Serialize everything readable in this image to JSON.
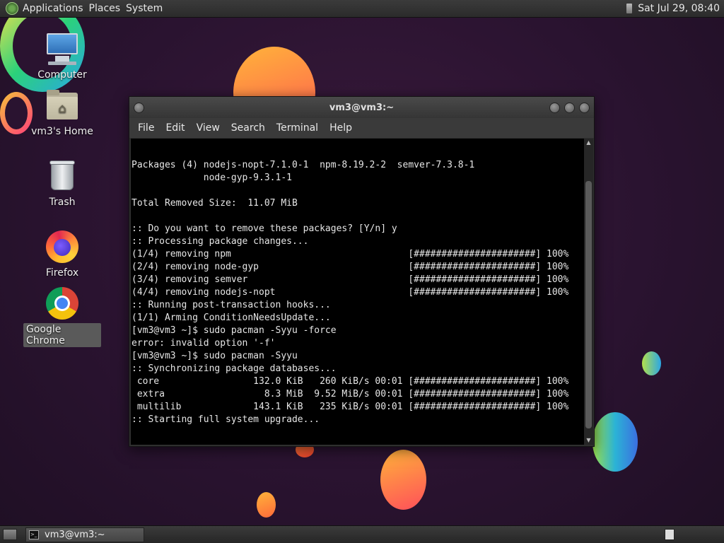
{
  "top_panel": {
    "menus": [
      "Applications",
      "Places",
      "System"
    ],
    "clock": "Sat Jul 29, 08:40"
  },
  "desktop": {
    "icons": [
      {
        "label": "Computer",
        "icon": "computer-icon"
      },
      {
        "label": "vm3's Home",
        "icon": "home-folder-icon"
      },
      {
        "label": "Trash",
        "icon": "trash-icon"
      },
      {
        "label": "Firefox",
        "icon": "firefox-icon"
      },
      {
        "label": "Google Chrome",
        "icon": "chrome-icon",
        "selected": true
      }
    ]
  },
  "terminal": {
    "title": "vm3@vm3:~",
    "menus": [
      "File",
      "Edit",
      "View",
      "Search",
      "Terminal",
      "Help"
    ],
    "lines": [
      "Packages (4) nodejs-nopt-7.1.0-1  npm-8.19.2-2  semver-7.3.8-1",
      "             node-gyp-9.3.1-1",
      "",
      "Total Removed Size:  11.07 MiB",
      "",
      ":: Do you want to remove these packages? [Y/n] y",
      ":: Processing package changes...",
      "(1/4) removing npm                                [######################] 100%",
      "(2/4) removing node-gyp                           [######################] 100%",
      "(3/4) removing semver                             [######################] 100%",
      "(4/4) removing nodejs-nopt                        [######################] 100%",
      ":: Running post-transaction hooks...",
      "(1/1) Arming ConditionNeedsUpdate...",
      "[vm3@vm3 ~]$ sudo pacman -Syyu -force",
      "error: invalid option '-f'",
      "[vm3@vm3 ~]$ sudo pacman -Syyu",
      ":: Synchronizing package databases...",
      " core                 132.0 KiB   260 KiB/s 00:01 [######################] 100%",
      " extra                  8.3 MiB  9.52 MiB/s 00:01 [######################] 100%",
      " multilib             143.1 KiB   235 KiB/s 00:01 [######################] 100%",
      ":: Starting full system upgrade..."
    ]
  },
  "taskbar": {
    "tasks": [
      {
        "label": "vm3@vm3:~",
        "icon": "terminal-icon"
      }
    ]
  },
  "colors": {
    "panel": "#2b2b2b",
    "terminal_bg": "#000000",
    "wallpaper": "#2a1330"
  }
}
